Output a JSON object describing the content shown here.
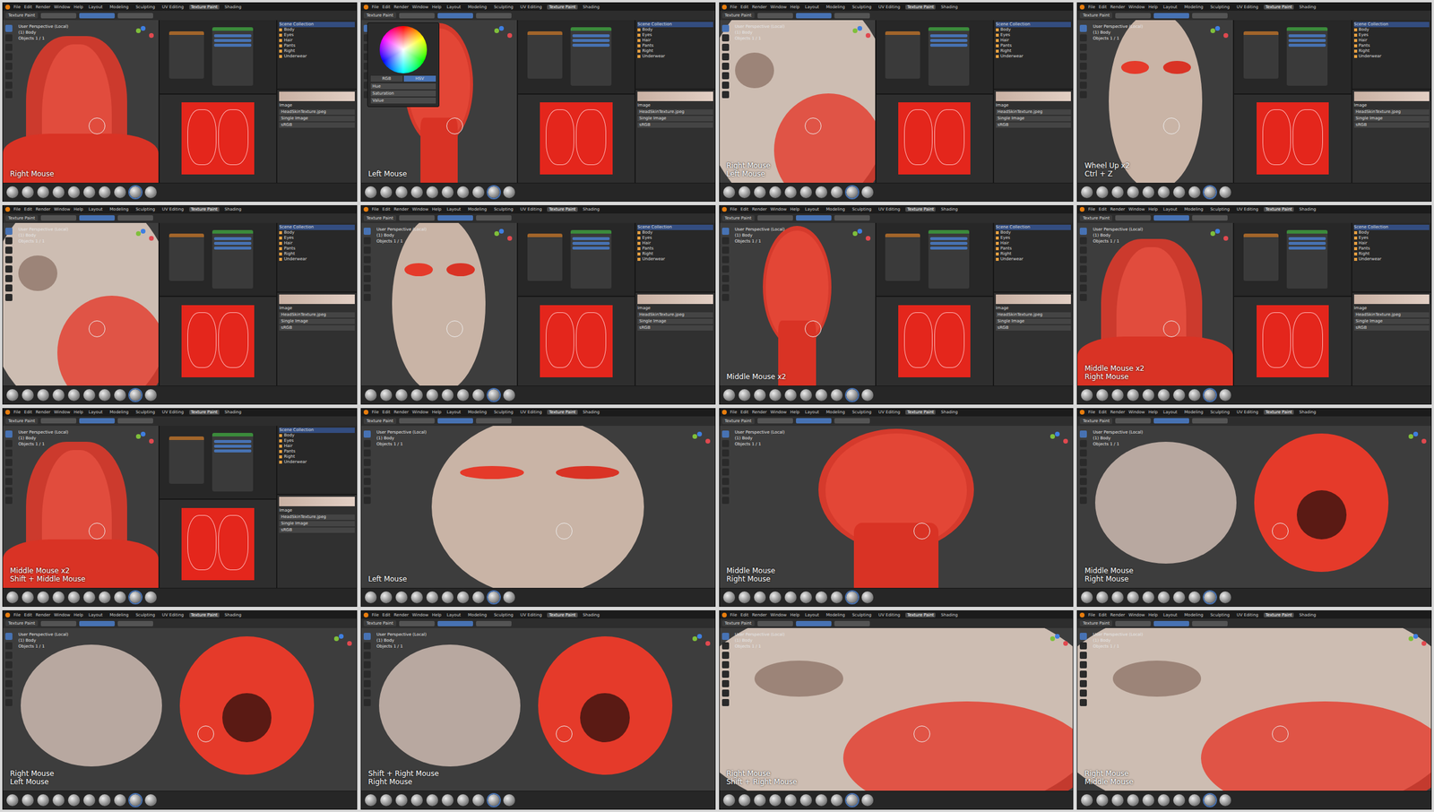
{
  "menu": [
    "File",
    "Edit",
    "Render",
    "Window",
    "Help"
  ],
  "workspaces": [
    {
      "label": "Layout",
      "selected": false
    },
    {
      "label": "Modeling",
      "selected": false
    },
    {
      "label": "Sculpting",
      "selected": false
    },
    {
      "label": "UV Editing",
      "selected": false
    },
    {
      "label": "Texture Paint",
      "selected": true
    },
    {
      "label": "Shading",
      "selected": false
    }
  ],
  "mode": "Texture Paint",
  "viewport_info": [
    "User Perspective (Local)",
    "(1) Body",
    "Objects 1 / 1"
  ],
  "outliner": {
    "title": "Scene Collection",
    "items": [
      "Body",
      "Eyes",
      "Hair",
      "Pants",
      "Right",
      "Underwear"
    ]
  },
  "image_props": {
    "section": "Image",
    "file": "HeadSkinTexture.jpeg",
    "source": "Single Image",
    "color_space": "sRGB"
  },
  "picker": {
    "modes": [
      {
        "label": "RGB",
        "selected": false
      },
      {
        "label": "HSV",
        "selected": true
      }
    ],
    "fields": [
      "Hue",
      "Saturation",
      "Value"
    ]
  },
  "frames": [
    {
      "layout": "split",
      "shot": "body",
      "picker": false,
      "keys": [
        "Right Mouse"
      ]
    },
    {
      "layout": "split",
      "shot": "head",
      "picker": true,
      "keys": [
        "Left Mouse"
      ]
    },
    {
      "layout": "split",
      "shot": "closeup",
      "picker": false,
      "keys": [
        "Right Mouse",
        "Left Mouse"
      ]
    },
    {
      "layout": "split",
      "shot": "face",
      "picker": false,
      "keys": [
        "Wheel Up x2",
        "Ctrl + Z"
      ]
    },
    {
      "layout": "split",
      "shot": "closeup",
      "picker": false,
      "keys": []
    },
    {
      "layout": "split",
      "shot": "face",
      "picker": false,
      "keys": []
    },
    {
      "layout": "split",
      "shot": "head",
      "picker": false,
      "keys": [
        "Middle Mouse x2"
      ]
    },
    {
      "layout": "split",
      "shot": "body",
      "picker": false,
      "keys": [
        "Middle Mouse x2",
        "Right Mouse"
      ]
    },
    {
      "layout": "split",
      "shot": "body",
      "picker": false,
      "keys": [
        "Middle Mouse x2",
        "Shift + Middle Mouse"
      ]
    },
    {
      "layout": "full",
      "shot": "face",
      "picker": false,
      "keys": [
        "Left Mouse"
      ]
    },
    {
      "layout": "full",
      "shot": "head",
      "picker": false,
      "keys": [
        "Middle Mouse",
        "Right Mouse"
      ]
    },
    {
      "layout": "full",
      "shot": "back",
      "picker": false,
      "keys": [
        "Middle Mouse",
        "Right Mouse"
      ]
    },
    {
      "layout": "full",
      "shot": "back",
      "picker": false,
      "keys": [
        "Right Mouse",
        "Left Mouse"
      ]
    },
    {
      "layout": "full",
      "shot": "back",
      "picker": false,
      "keys": [
        "Shift + Right Mouse",
        "Right Mouse"
      ]
    },
    {
      "layout": "full",
      "shot": "closeup",
      "picker": false,
      "keys": [
        "Right Mouse",
        "Shift + Right Mouse"
      ]
    },
    {
      "layout": "full",
      "shot": "closeup",
      "picker": false,
      "keys": [
        "Right Mouse",
        "Middle Mouse"
      ]
    }
  ]
}
